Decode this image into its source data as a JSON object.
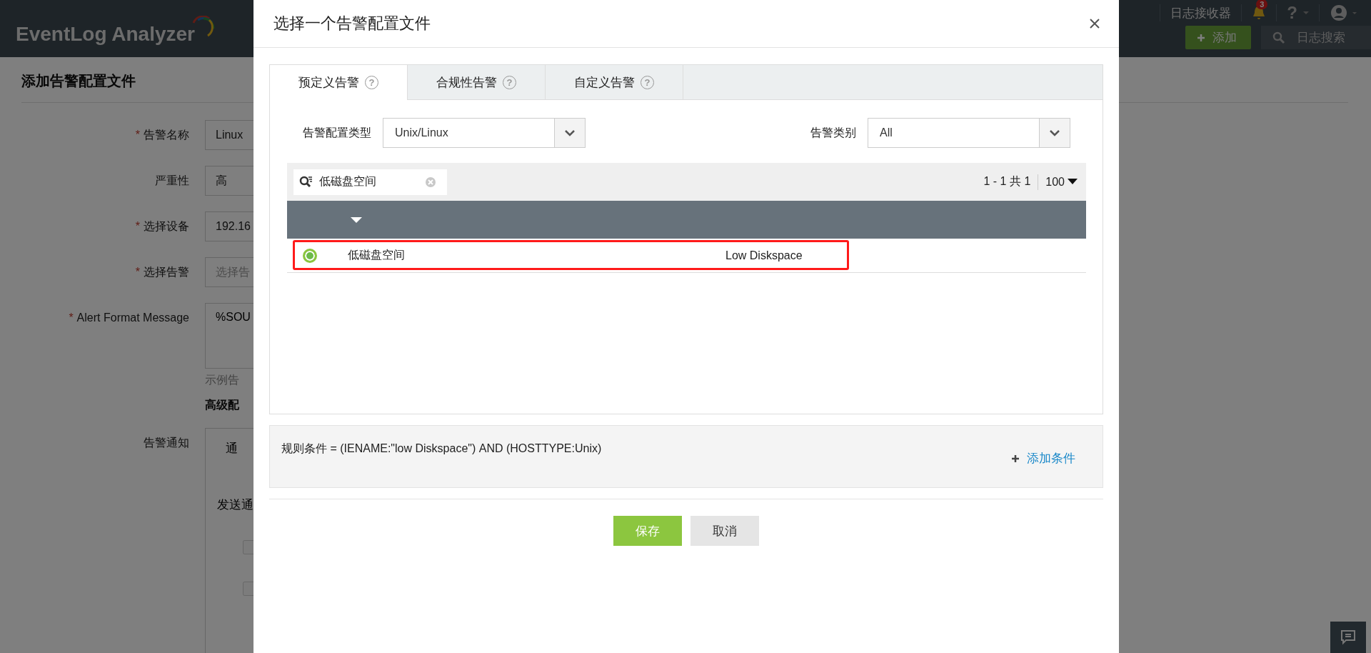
{
  "header": {
    "logo": "EventLog Analyzer",
    "receiver_link": "日志接收器",
    "notification_count": "3",
    "help_mark": "?",
    "add_button": "添加",
    "search_placeholder": "日志搜索"
  },
  "page": {
    "title": "添加告警配置文件",
    "fields": [
      {
        "kind": "input",
        "required_mark": "*",
        "label": "告警名称",
        "value": "Linux"
      },
      {
        "kind": "input",
        "label": "严重性",
        "value": "高"
      },
      {
        "kind": "input",
        "required_mark": "*",
        "label": "选择设备",
        "value": "192.16"
      },
      {
        "kind": "input",
        "required_mark": "*",
        "label": "选择告警",
        "placeholder": "选择告"
      },
      {
        "kind": "textarea",
        "required_mark": "*",
        "label": "Alert Format Message",
        "value": "%SOU",
        "hint": "示例告"
      }
    ],
    "section_title": "高级配",
    "notification": {
      "label": "告警通知",
      "tab": "通",
      "text": "发送通",
      "checkboxes": [
        {
          "checked": false
        },
        {
          "checked": false
        }
      ]
    }
  },
  "modal": {
    "title": "选择一个告警配置文件",
    "tabs": [
      {
        "label": "预定义告警",
        "help": "?",
        "selected": true
      },
      {
        "label": "合规性告警",
        "help": "?",
        "selected": false
      },
      {
        "label": "自定义告警",
        "help": "?",
        "selected": false
      }
    ],
    "filters": [
      {
        "label": "告警配置类型",
        "value": "Unix/Linux"
      },
      {
        "label": "告警类别",
        "value": "All"
      }
    ],
    "search": {
      "value": "低磁盘空间"
    },
    "pagination": {
      "range": "1 - 1 共 1",
      "page_size": "100"
    },
    "rows": [
      {
        "selected": true,
        "highlighted": true,
        "cells": [
          "低磁盘空间",
          "Low Diskspace"
        ]
      }
    ],
    "rule": {
      "text": "规则条件 = (IENAME:\"low Diskspace\") AND (HOSTTYPE:Unix)",
      "add_link": "添加条件"
    },
    "buttons": [
      {
        "kind": "primary",
        "label": "保存"
      },
      {
        "kind": "secondary",
        "label": "取消"
      }
    ]
  }
}
